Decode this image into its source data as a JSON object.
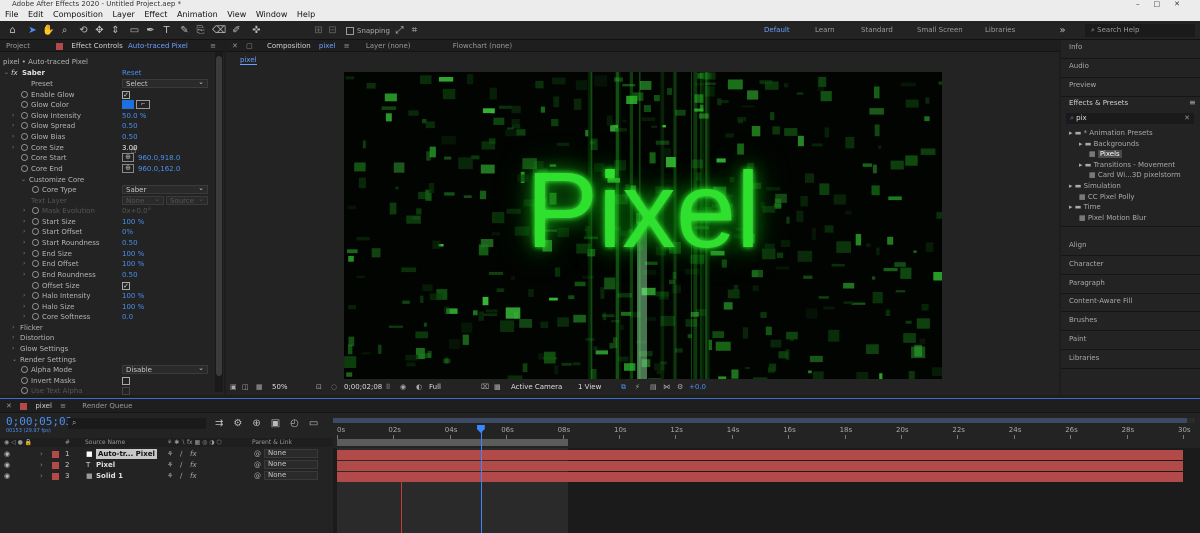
{
  "app": {
    "title": "Adobe After Effects 2020 - Untitled Project.aep *",
    "menu": [
      "File",
      "Edit",
      "Composition",
      "Layer",
      "Effect",
      "Animation",
      "View",
      "Window",
      "Help"
    ],
    "snapping_label": "Snapping",
    "workspaces": [
      "Default",
      "Learn",
      "Standard",
      "Small Screen",
      "Libraries"
    ],
    "search_placeholder": "Search Help"
  },
  "effect_controls": {
    "tab_project": "Project",
    "tab_label": "Effect Controls",
    "tab_target": "Auto-traced Pixel",
    "layer_path": "pixel • Auto-traced Pixel",
    "effect_name": "Saber",
    "reset_label": "Reset",
    "props": {
      "preset": {
        "label": "Preset",
        "value": "Select"
      },
      "enable_glow": {
        "label": "Enable Glow",
        "checked": true
      },
      "glow_color": {
        "label": "Glow Color",
        "color": "#1e6fe0"
      },
      "glow_intensity": {
        "label": "Glow Intensity",
        "value": "50.0 %"
      },
      "glow_spread": {
        "label": "Glow Spread",
        "value": "0.50"
      },
      "glow_bias": {
        "label": "Glow Bias",
        "value": "0.50"
      },
      "core_size": {
        "label": "Core Size",
        "value": "3.00"
      },
      "core_start": {
        "label": "Core Start",
        "value": "960.0,918.0"
      },
      "core_end": {
        "label": "Core End",
        "value": "960.0,162.0"
      },
      "customize_core": {
        "label": "Customize Core"
      },
      "core_type": {
        "label": "Core Type",
        "value": "Saber"
      },
      "text_layer": {
        "label": "Text Layer",
        "value": "None",
        "value2": "Source"
      },
      "mask_evolution": {
        "label": "Mask Evolution",
        "value": "0x+0.0°"
      },
      "start_size": {
        "label": "Start Size",
        "value": "100 %"
      },
      "start_offset": {
        "label": "Start Offset",
        "value": "0%"
      },
      "start_roundness": {
        "label": "Start Roundness",
        "value": "0.50"
      },
      "end_size": {
        "label": "End Size",
        "value": "100 %"
      },
      "end_offset": {
        "label": "End Offset",
        "value": "100 %"
      },
      "end_roundness": {
        "label": "End Roundness",
        "value": "0.50"
      },
      "offset_size": {
        "label": "Offset Size",
        "checked": true
      },
      "halo_intensity": {
        "label": "Halo Intensity",
        "value": "100 %"
      },
      "halo_size": {
        "label": "Halo Size",
        "value": "100 %"
      },
      "core_softness": {
        "label": "Core Softness",
        "value": "0.0"
      },
      "flicker": {
        "label": "Flicker"
      },
      "distortion": {
        "label": "Distortion"
      },
      "glow_settings": {
        "label": "Glow Settings"
      },
      "render_settings": {
        "label": "Render Settings"
      },
      "alpha_mode": {
        "label": "Alpha Mode",
        "value": "Disable"
      },
      "invert_masks": {
        "label": "Invert Masks",
        "checked": false
      },
      "use_text_alpha": {
        "label": "Use Text Alpha"
      }
    }
  },
  "composition": {
    "tab_label": "Composition",
    "comp_name": "pixel",
    "layer_tab": "Layer (none)",
    "flowchart_tab": "Flowchart (none)",
    "breadcrumb": "pixel",
    "viewer_text": "Pixel",
    "zoom": "50%",
    "timecode": "0;00;02;08",
    "resolution": "Full",
    "camera": "Active Camera",
    "views": "1 View",
    "exposure": "+0.0"
  },
  "right_panel": {
    "sections_top": [
      "Info",
      "Audio",
      "Preview"
    ],
    "effects_presets_label": "Effects & Presets",
    "search_value": "pix",
    "tree": [
      {
        "label": "* Animation Presets",
        "level": 0
      },
      {
        "label": "Backgrounds",
        "level": 1
      },
      {
        "label": "Pixels",
        "level": 2,
        "selected": true
      },
      {
        "label": "Transitions - Movement",
        "level": 1
      },
      {
        "label": "Card Wi...3D pixelstorm",
        "level": 2
      },
      {
        "label": "Simulation",
        "level": 0
      },
      {
        "label": "CC Pixel Polly",
        "level": 1
      },
      {
        "label": "Time",
        "level": 0
      },
      {
        "label": "Pixel Motion Blur",
        "level": 1
      }
    ],
    "sections_bottom": [
      "Align",
      "Character",
      "Paragraph",
      "Content-Aware Fill",
      "Brushes",
      "Paint",
      "Libraries"
    ]
  },
  "timeline": {
    "tab_label": "pixel",
    "render_queue_label": "Render Queue",
    "timecode": "0;00;05;03",
    "frame_info": "00153 (29.97 fps)",
    "col_source": "Source Name",
    "col_parent": "Parent & Link",
    "layers": [
      {
        "index": "1",
        "name": "Auto-tr... Pixel",
        "parent": "None",
        "color": "#b24a4a",
        "type": "solid-white"
      },
      {
        "index": "2",
        "name": "Pixel",
        "parent": "None",
        "color": "#b24a4a",
        "type": "text"
      },
      {
        "index": "3",
        "name": "Solid 1",
        "parent": "None",
        "color": "#b24a4a",
        "type": "solid-red"
      }
    ],
    "ruler_ticks": [
      "0s",
      "02s",
      "04s",
      "06s",
      "08s",
      "10s",
      "12s",
      "14s",
      "16s",
      "18s",
      "20s",
      "22s",
      "24s",
      "26s",
      "28s",
      "30s"
    ],
    "playhead_seconds": 5.1,
    "work_area_end_seconds": 8.2,
    "duration_seconds": 30
  }
}
